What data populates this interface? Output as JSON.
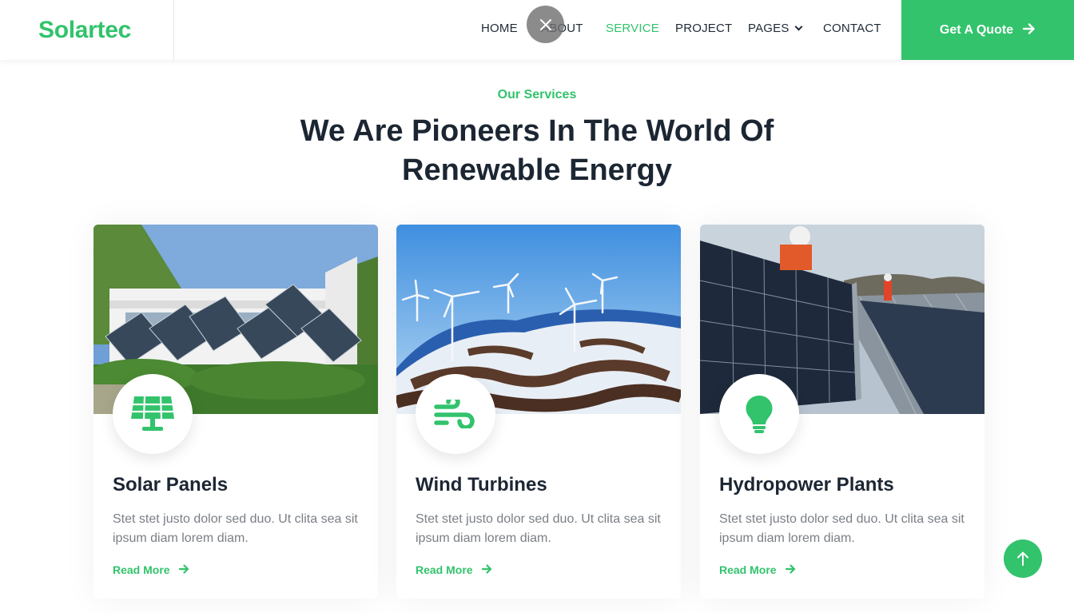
{
  "brand": {
    "name": "Solartec"
  },
  "nav": {
    "items": [
      {
        "label": "HOME",
        "active": false
      },
      {
        "label": "ABOUT",
        "active": false
      },
      {
        "label": "SERVICE",
        "active": true
      },
      {
        "label": "PROJECT",
        "active": false
      },
      {
        "label": "PAGES",
        "active": false,
        "dropdown": true
      },
      {
        "label": "CONTACT",
        "active": false
      }
    ],
    "cta_label": "Get A Quote"
  },
  "section": {
    "eyebrow": "Our Services",
    "heading_line1": "We Are Pioneers In The World Of",
    "heading_line2": "Renewable Energy"
  },
  "cards": [
    {
      "title": "Solar Panels",
      "text": "Stet stet justo dolor sed duo. Ut clita sea sit ipsum diam lorem diam.",
      "link": "Read More",
      "icon": "solar-panel-icon"
    },
    {
      "title": "Wind Turbines",
      "text": "Stet stet justo dolor sed duo. Ut clita sea sit ipsum diam lorem diam.",
      "link": "Read More",
      "icon": "wind-icon"
    },
    {
      "title": "Hydropower Plants",
      "text": "Stet stet justo dolor sed duo. Ut clita sea sit ipsum diam lorem diam.",
      "link": "Read More",
      "icon": "lightbulb-icon"
    }
  ],
  "colors": {
    "accent": "#32c36c",
    "heading": "#1c2633",
    "body_text": "#7a7f85"
  }
}
